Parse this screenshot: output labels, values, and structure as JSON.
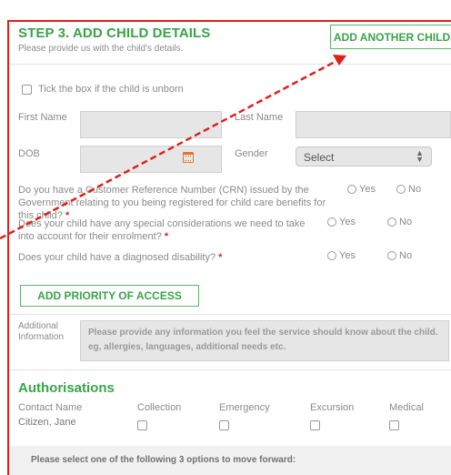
{
  "step": {
    "title": "STEP 3. ADD CHILD DETAILS",
    "subtitle": "Please provide us with the child's details.",
    "add_another_label": "ADD ANOTHER CHILD"
  },
  "unborn_label": "Tick the box if the child is unborn",
  "fields": {
    "first_name_label": "First Name",
    "last_name_label": "Last Name",
    "dob_label": "DOB",
    "gender_label": "Gender",
    "gender_selected": "Select"
  },
  "questions": [
    {
      "text": "Do you have a Customer Reference Number (CRN) issued by the Government relating to you being registered for child care benefits for this child?",
      "yes": "Yes",
      "no": "No"
    },
    {
      "text": "Does your child have any special considerations we need to take into account for their enrolment?",
      "yes": "Yes",
      "no": "No"
    },
    {
      "text": "Does your child have a diagnosed disability?",
      "yes": "Yes",
      "no": "No"
    }
  ],
  "required_mark": "*",
  "priority_label": "ADD PRIORITY OF ACCESS",
  "additional": {
    "label": "Additional Information",
    "placeholder": "Please provide any information you feel the service should know about the child. eg, allergies, languages, additional needs etc."
  },
  "authorisations": {
    "title": "Authorisations",
    "headers": [
      "Contact Name",
      "Collection",
      "Emergency",
      "Excursion",
      "Medical"
    ],
    "rows": [
      {
        "name": "Citizen, Jane"
      }
    ]
  },
  "footer_text": "Please select one of the following 3 options to move forward:",
  "colors": {
    "accent": "#3aa34a",
    "annotation": "#e0201a",
    "required": "#c0312b"
  }
}
